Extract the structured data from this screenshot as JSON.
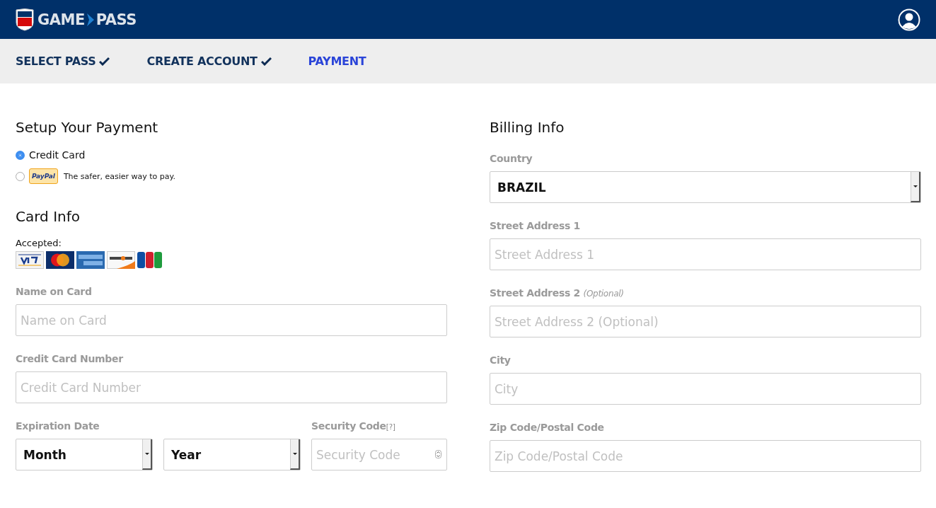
{
  "header": {
    "logo": {
      "word_1": "GAME",
      "word_2": "PASS"
    }
  },
  "steps": [
    {
      "label": "SELECT PASS",
      "done": true,
      "selected": false
    },
    {
      "label": "CREATE ACCOUNT",
      "done": true,
      "selected": false
    },
    {
      "label": "PAYMENT",
      "done": false,
      "selected": true
    }
  ],
  "payment": {
    "title": "Setup Your Payment",
    "methods": [
      {
        "kind": "card",
        "label": "Credit Card",
        "selected": true
      },
      {
        "kind": "paypal",
        "badge": "PayPal",
        "label": "The safer, easier way to pay.",
        "selected": false
      }
    ]
  },
  "card_info": {
    "title": "Card Info",
    "accepted_label": "Accepted:",
    "fields": [
      {
        "label": "Name on Card",
        "placeholder": "Name on Card"
      },
      {
        "label": "Credit Card Number",
        "placeholder": "Credit Card Number"
      }
    ],
    "expiration": {
      "label": "Expiration Date",
      "month": "Month",
      "year": "Year"
    },
    "security": {
      "label": "Security Code",
      "help": "[?]",
      "placeholder": "Security Code"
    }
  },
  "billing": {
    "title": "Billing Info",
    "country": {
      "label": "Country",
      "value": "BRAZIL"
    },
    "fields": [
      {
        "label": "Street Address 1",
        "placeholder": "Street Address 1"
      },
      {
        "label": "Street Address 2",
        "note": "(Optional)",
        "placeholder": "Street Address 2 (Optional)"
      },
      {
        "label": "City",
        "placeholder": "City"
      },
      {
        "label": "Zip Code/Postal Code",
        "placeholder": "Zip Code/Postal Code"
      }
    ]
  }
}
